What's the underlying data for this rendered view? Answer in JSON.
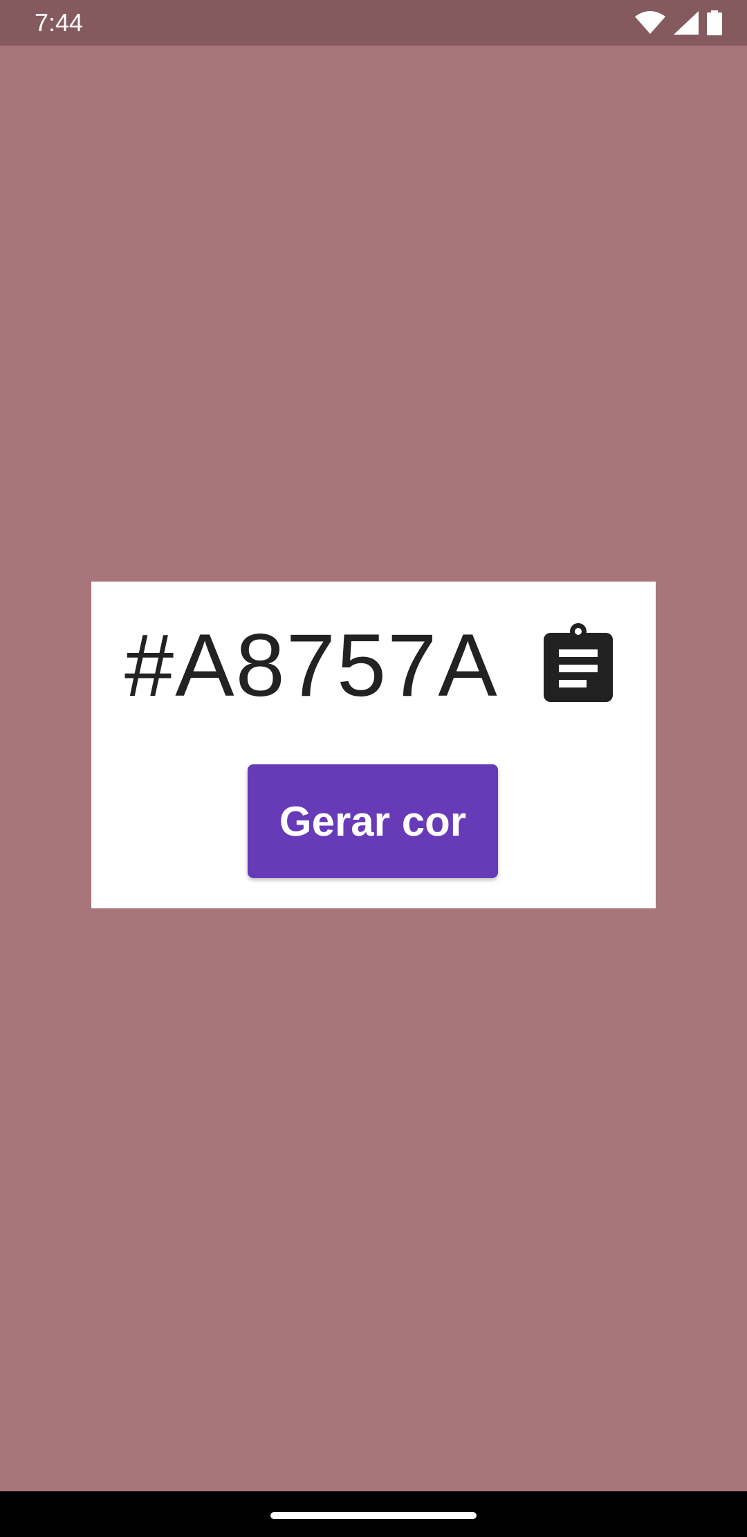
{
  "status_bar": {
    "time": "7:44",
    "icons": [
      "wifi-icon",
      "cellular-signal-icon",
      "battery-icon"
    ]
  },
  "main": {
    "hex_value": "#A8757A",
    "copy_icon": "clipboard-icon",
    "generate_button_label": "Gerar cor"
  },
  "colors": {
    "background": "#A8757A",
    "status_bar": "#855A5F",
    "card": "#FFFFFF",
    "button": "#673AB7",
    "text": "#222222"
  }
}
